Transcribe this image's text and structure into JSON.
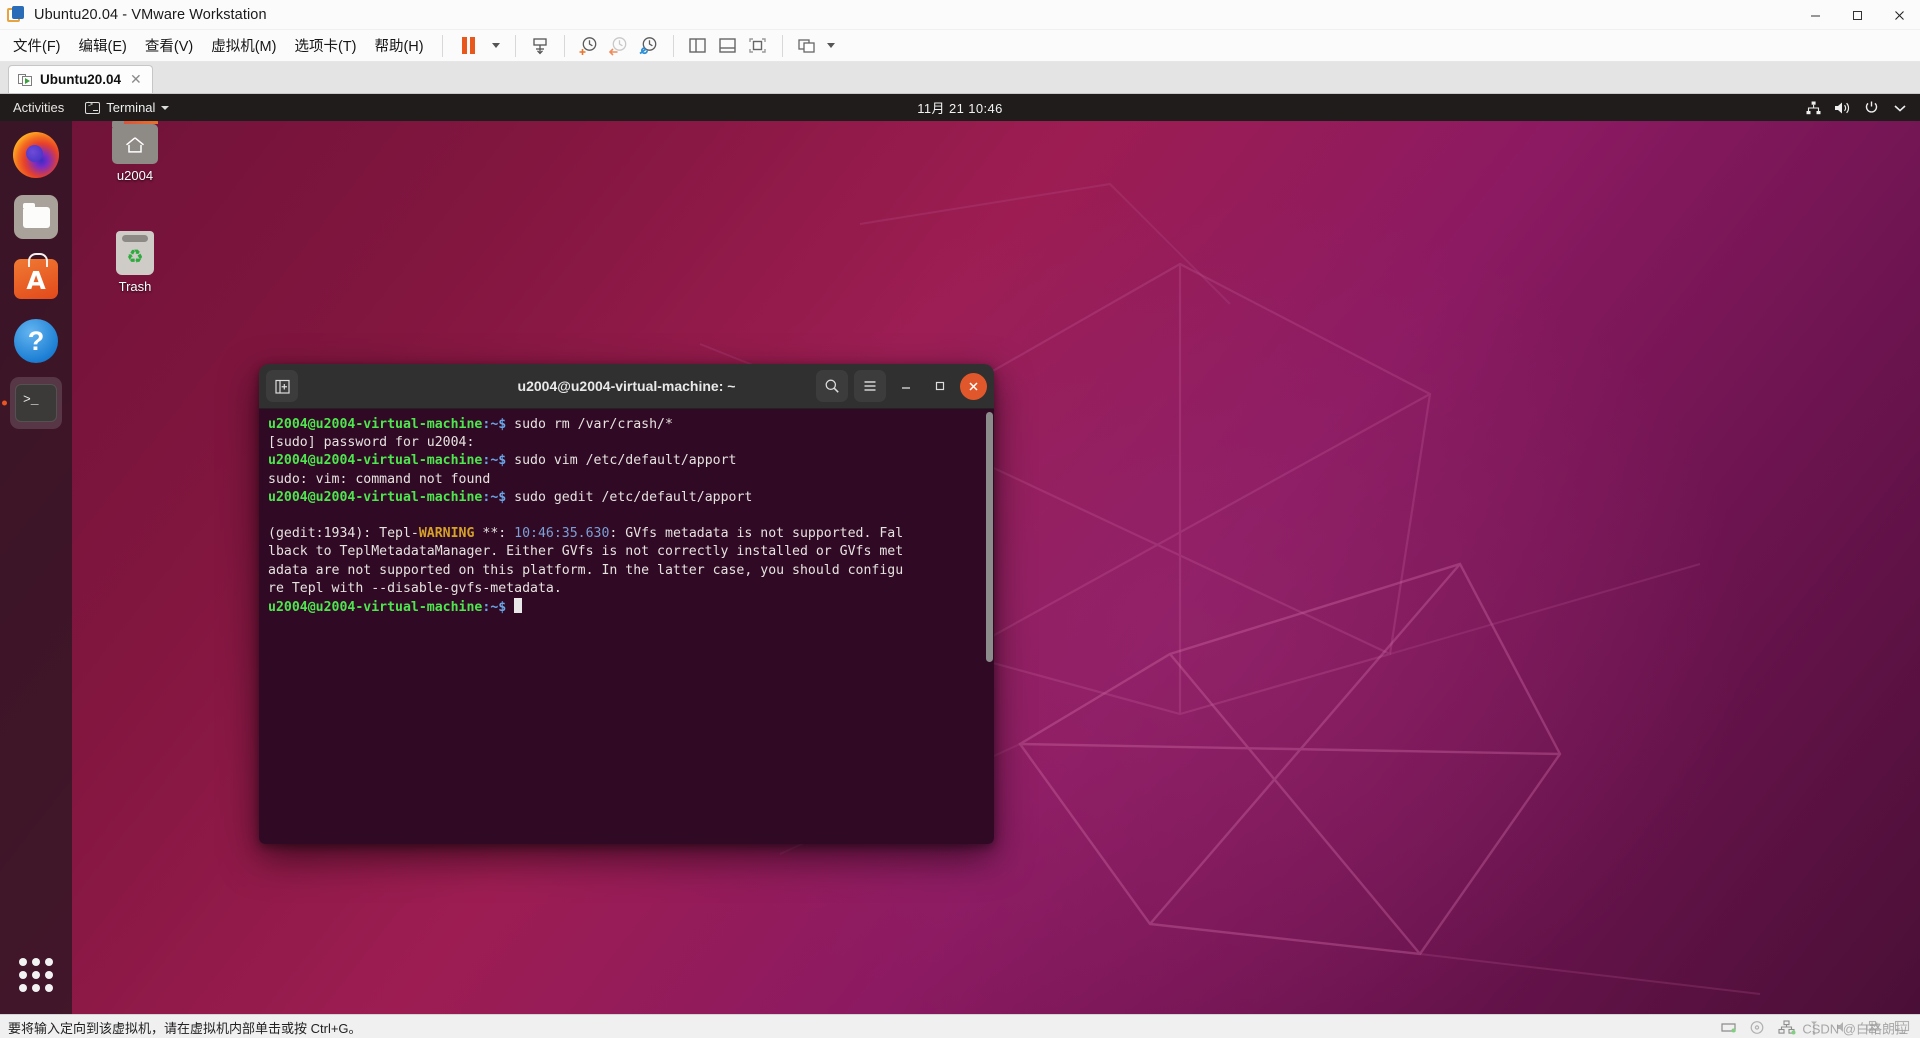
{
  "window": {
    "title": "Ubuntu20.04 - VMware Workstation",
    "app_icon": "vmware-logo-icon",
    "minimize_label": "—",
    "maximize_label": "❐",
    "close_label": "✕"
  },
  "menubar": {
    "items": [
      {
        "label": "文件(F)",
        "name": "menu-file"
      },
      {
        "label": "编辑(E)",
        "name": "menu-edit"
      },
      {
        "label": "查看(V)",
        "name": "menu-view"
      },
      {
        "label": "虚拟机(M)",
        "name": "menu-vm"
      },
      {
        "label": "选项卡(T)",
        "name": "menu-tabs"
      },
      {
        "label": "帮助(H)",
        "name": "menu-help"
      }
    ],
    "toolbar": [
      {
        "name": "suspend-button",
        "icon": "pause-icon"
      },
      {
        "name": "suspend-dropdown",
        "icon": "chevron-down-icon"
      },
      {
        "name": "send-ctrl-alt-del-button",
        "icon": "keyboard-send-icon"
      },
      {
        "name": "take-snapshot-button",
        "icon": "snapshot-add-icon"
      },
      {
        "name": "revert-snapshot-button",
        "icon": "snapshot-revert-icon"
      },
      {
        "name": "manage-snapshots-button",
        "icon": "snapshot-manage-icon"
      },
      {
        "name": "show-sidebar-button",
        "icon": "panel-left-icon"
      },
      {
        "name": "show-thumbnail-bar-button",
        "icon": "panel-bottom-icon"
      },
      {
        "name": "fullscreen-button",
        "icon": "fullscreen-icon"
      },
      {
        "name": "unity-mode-button",
        "icon": "unity-icon"
      },
      {
        "name": "unity-dropdown",
        "icon": "chevron-down-icon"
      }
    ]
  },
  "tabs": [
    {
      "label": "Ubuntu20.04",
      "icon": "vm-running-icon",
      "close": "✕",
      "active": true
    }
  ],
  "guest": {
    "topbar": {
      "activities": "Activities",
      "app_menu": "Terminal",
      "app_icon": "terminal-icon",
      "clock": "11月 21  10:46",
      "tray": [
        {
          "name": "network-icon",
          "glyph": "⛓"
        },
        {
          "name": "volume-icon",
          "glyph": "🔊"
        },
        {
          "name": "power-icon",
          "glyph": "⏻"
        },
        {
          "name": "system-menu-chevron-icon",
          "glyph": "▾"
        }
      ]
    },
    "dock": [
      {
        "name": "dock-item-firefox",
        "icon": "firefox-icon",
        "running": false
      },
      {
        "name": "dock-item-files",
        "icon": "files-icon",
        "running": false
      },
      {
        "name": "dock-item-software",
        "icon": "ubuntu-software-icon",
        "running": false
      },
      {
        "name": "dock-item-help",
        "icon": "help-icon",
        "running": false
      },
      {
        "name": "dock-item-terminal",
        "icon": "terminal-icon",
        "running": true
      }
    ],
    "dock_show_apps": "show-applications-icon",
    "desktop_icons": [
      {
        "label": "u2004",
        "icon": "home-folder-icon"
      },
      {
        "label": "Trash",
        "icon": "trash-icon"
      }
    ],
    "terminal": {
      "title": "u2004@u2004-virtual-machine: ~",
      "new_tab_label": "+",
      "search_label": "⌕",
      "menu_label": "☰",
      "minimize_label": "–",
      "maximize_label": "□",
      "close_label": "✕",
      "lines": [
        {
          "type": "prompt",
          "user": "u2004@u2004-virtual-machine",
          "path": ":~$ ",
          "cmd": "sudo rm /var/crash/*"
        },
        {
          "type": "plain",
          "text": "[sudo] password for u2004:"
        },
        {
          "type": "prompt",
          "user": "u2004@u2004-virtual-machine",
          "path": ":~$ ",
          "cmd": "sudo vim /etc/default/apport"
        },
        {
          "type": "plain",
          "text": "sudo: vim: command not found"
        },
        {
          "type": "prompt",
          "user": "u2004@u2004-virtual-machine",
          "path": ":~$ ",
          "cmd": "sudo gedit /etc/default/apport"
        },
        {
          "type": "blank",
          "text": ""
        },
        {
          "type": "warning",
          "pre": "(gedit:1934): Tepl-",
          "tag": "WARNING",
          "mid": " **: ",
          "time": "10:46:35.630",
          "post": ": GVfs metadata is not supported. Fal"
        },
        {
          "type": "plain",
          "text": "lback to TeplMetadataManager. Either GVfs is not correctly installed or GVfs met"
        },
        {
          "type": "plain",
          "text": "adata are not supported on this platform. In the latter case, you should configu"
        },
        {
          "type": "plain",
          "text": "re Tepl with --disable-gvfs-metadata."
        },
        {
          "type": "prompt-cursor",
          "user": "u2004@u2004-virtual-machine",
          "path": ":~$ ",
          "cmd": ""
        }
      ]
    }
  },
  "statusbar": {
    "hint": "要将输入定向到该虚拟机，请在虚拟机内部单击或按 Ctrl+G。",
    "devices": [
      {
        "name": "hard-disk-icon"
      },
      {
        "name": "cd-dvd-icon"
      },
      {
        "name": "network-adapter-icon"
      },
      {
        "name": "usb-icon"
      },
      {
        "name": "sound-card-icon"
      },
      {
        "name": "printer-icon"
      },
      {
        "name": "display-icon"
      }
    ],
    "watermark": "CSDN @白格朗拉"
  },
  "colors": {
    "accent_orange": "#e95420",
    "terminal_bg": "#300a24",
    "prompt_green": "#4ee64e",
    "prompt_blue": "#6aa5e8",
    "warn_yellow": "#d6a228"
  }
}
